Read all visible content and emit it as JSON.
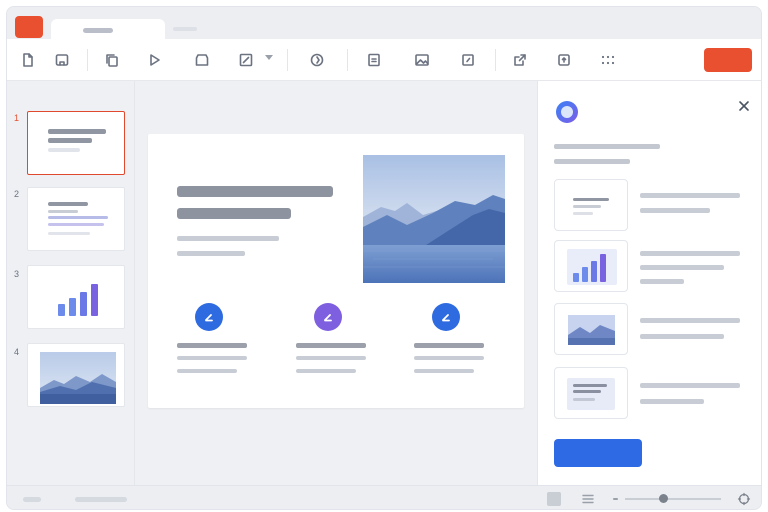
{
  "colors": {
    "brand": "#e9502f",
    "selection": "#e0492d",
    "primary_button": "#2e6ae3",
    "chart_bar_blue": "#5b7fe6",
    "chart_bar_purple": "#7a63e0"
  },
  "tabbar": {
    "logo_icon": "app-logo-icon"
  },
  "toolbar": {
    "icons": [
      "new-file-icon",
      "open-icon",
      "copy-icon",
      "play-icon",
      "layout-icon",
      "pen-icon",
      "theme-icon",
      "textbox-icon",
      "image-icon",
      "shape-icon",
      "share-icon",
      "export-icon",
      "grid-more-icon"
    ]
  },
  "slides": {
    "numbers": [
      "1",
      "2",
      "3",
      "4"
    ],
    "selected": "1"
  },
  "main_slide": {
    "feature_icons": [
      "pen-icon",
      "pen-icon",
      "pen-icon"
    ]
  },
  "assistant_panel": {
    "logo_icon": "assistant-ring-icon",
    "close_icon": "close-icon",
    "card_icons": [
      "text-layout-icon",
      "bar-chart-icon",
      "image-layout-icon",
      "text-block-icon"
    ]
  },
  "statusbar": {
    "zoom_level_fraction": 0.4,
    "view_icons": [
      "normal-view-icon",
      "outline-view-icon"
    ],
    "fit_icon": "fit-to-window-icon"
  }
}
